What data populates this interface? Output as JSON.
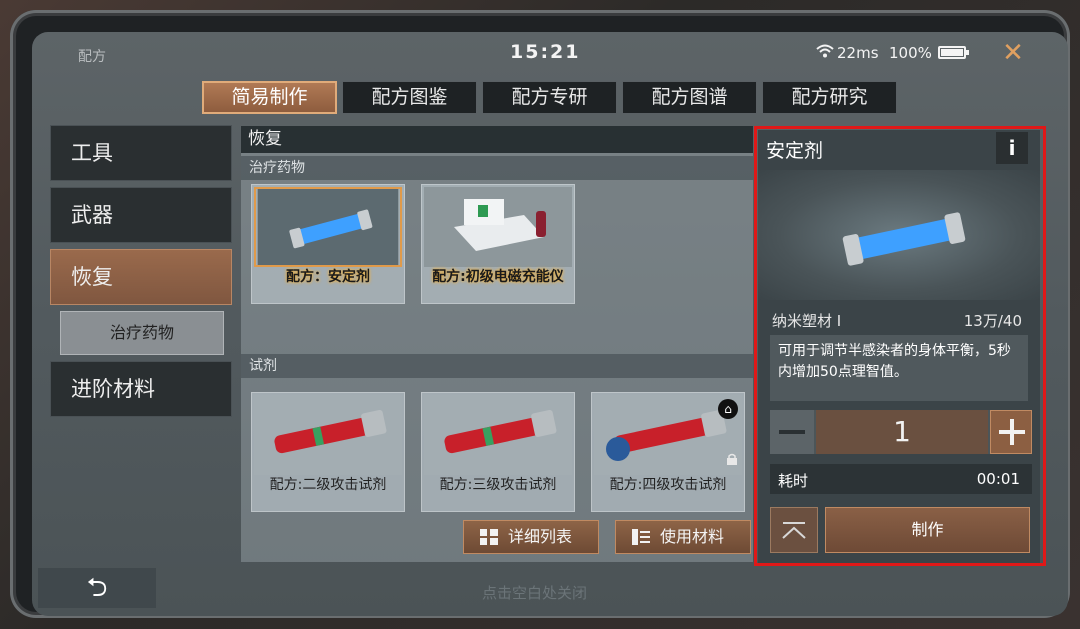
{
  "window": {
    "title": "配方"
  },
  "status": {
    "time": "15:21",
    "ping": "22ms",
    "battery": "100%"
  },
  "tabs": [
    {
      "label": "简易制作",
      "active": true
    },
    {
      "label": "配方图鉴"
    },
    {
      "label": "配方专研"
    },
    {
      "label": "配方图谱"
    },
    {
      "label": "配方研究"
    }
  ],
  "sidebar": {
    "items": [
      {
        "label": "工具"
      },
      {
        "label": "武器"
      },
      {
        "label": "恢复",
        "active": true
      },
      {
        "label": "进阶材料"
      }
    ],
    "subitem": "治疗药物"
  },
  "center": {
    "header": "恢复",
    "sections": [
      {
        "label": "治疗药物",
        "items": [
          "配方：安定剂",
          "配方:初级电磁充能仪"
        ]
      },
      {
        "label": "试剂",
        "items": [
          "配方:二级攻击试剂",
          "配方:三级攻击试剂",
          "配方:四级攻击试剂"
        ]
      }
    ],
    "buttons": {
      "detail_list": "详细列表",
      "use_material": "使用材料"
    }
  },
  "detail": {
    "title": "安定剂",
    "info": "i",
    "material_name": "纳米塑材 I",
    "material_count": "13万/40",
    "description": "可用于调节半感染者的身体平衡，5秒内增加50点理智值。",
    "quantity": "1",
    "time_label": "耗时",
    "time_value": "00:01",
    "make_label": "制作"
  },
  "footer": {
    "hint": "点击空白处关闭",
    "back": "⮌"
  },
  "colors": {
    "accent": "#e0ab7a",
    "highlight": "#e01818",
    "selected_border": "#e09a4a"
  }
}
